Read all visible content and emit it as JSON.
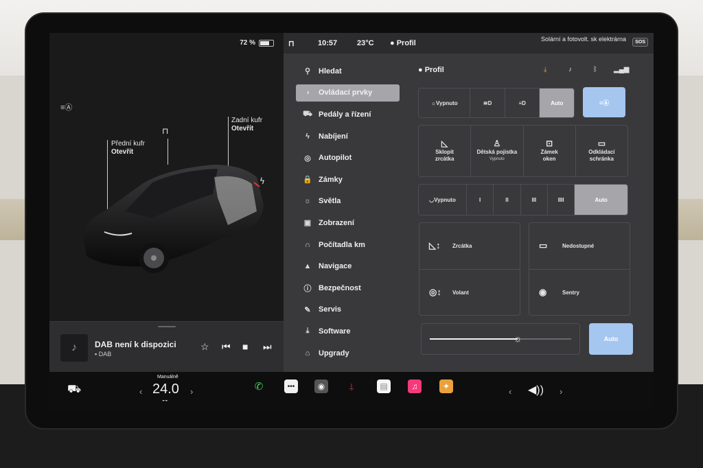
{
  "status": {
    "battery": "72 %",
    "battery_level": 0.72,
    "time": "10:57",
    "temperature": "23°C",
    "profile": "Profil",
    "map_hint": "Solární a fotovolt. sk elektrárna",
    "sos": "SOS"
  },
  "car": {
    "front_trunk_title": "Přední kufr",
    "front_trunk_action": "Otevřít",
    "rear_trunk_title": "Zadní kufr",
    "rear_trunk_action": "Otevřít"
  },
  "media": {
    "title": "DAB není k dispozici",
    "source": "DAB"
  },
  "menu": {
    "items": [
      {
        "label": "Hledat",
        "icon": "search-icon",
        "glyph": "⚲"
      },
      {
        "label": "Ovládací prvky",
        "icon": "toggle-icon",
        "glyph": "◑",
        "active": true
      },
      {
        "label": "Pedály a řízení",
        "icon": "car-icon",
        "glyph": "⛟"
      },
      {
        "label": "Nabíjení",
        "icon": "bolt-icon",
        "glyph": "ϟ"
      },
      {
        "label": "Autopilot",
        "icon": "steering-wheel-icon",
        "glyph": "◎"
      },
      {
        "label": "Zámky",
        "icon": "lock-icon",
        "glyph": "🔒"
      },
      {
        "label": "Světla",
        "icon": "sun-icon",
        "glyph": "☼"
      },
      {
        "label": "Zobrazení",
        "icon": "display-icon",
        "glyph": "▣"
      },
      {
        "label": "Počítadla km",
        "icon": "odometer-icon",
        "glyph": "∩"
      },
      {
        "label": "Navigace",
        "icon": "navigation-arrow-icon",
        "glyph": "▲"
      },
      {
        "label": "Bezpečnost",
        "icon": "alert-circle-icon",
        "glyph": "ⓘ"
      },
      {
        "label": "Servis",
        "icon": "wrench-icon",
        "glyph": "✎"
      },
      {
        "label": "Software",
        "icon": "download-icon",
        "glyph": "⤓"
      },
      {
        "label": "Upgrady",
        "icon": "bag-icon",
        "glyph": "⌂"
      }
    ]
  },
  "controls": {
    "profile": "Profil",
    "lights": {
      "options": [
        "Vypnuto",
        "",
        "",
        "Auto"
      ],
      "selected": "Auto"
    },
    "tiles": [
      {
        "label1": "Sklopit",
        "label2": "zrcátka",
        "sub": ""
      },
      {
        "label1": "Dětská pojistka",
        "label2": "",
        "sub": "Vypnuto"
      },
      {
        "label1": "Zámek",
        "label2": "oken",
        "sub": ""
      },
      {
        "label1": "Odkládací",
        "label2": "schránka",
        "sub": ""
      }
    ],
    "wipers": {
      "options": [
        "Vypnuto",
        "I",
        "II",
        "III",
        "IIII",
        "Auto"
      ],
      "selected": "Auto"
    },
    "adjust": {
      "mirrors": "Zrcátka",
      "wheel": "Volant"
    },
    "extras": {
      "unavailable": "Nedostupné",
      "sentry": "Sentry"
    },
    "brightness": {
      "level": 0.62,
      "auto_label": "Auto"
    }
  },
  "dock": {
    "gear_mode": "Manuálně",
    "temp_value": "24.0",
    "left_arrow": "‹",
    "right_arrow": "›"
  },
  "colors": {
    "accent_blue": "#a5c6ef",
    "selected_gray": "#a6a6aa",
    "panel": "#39393c"
  }
}
